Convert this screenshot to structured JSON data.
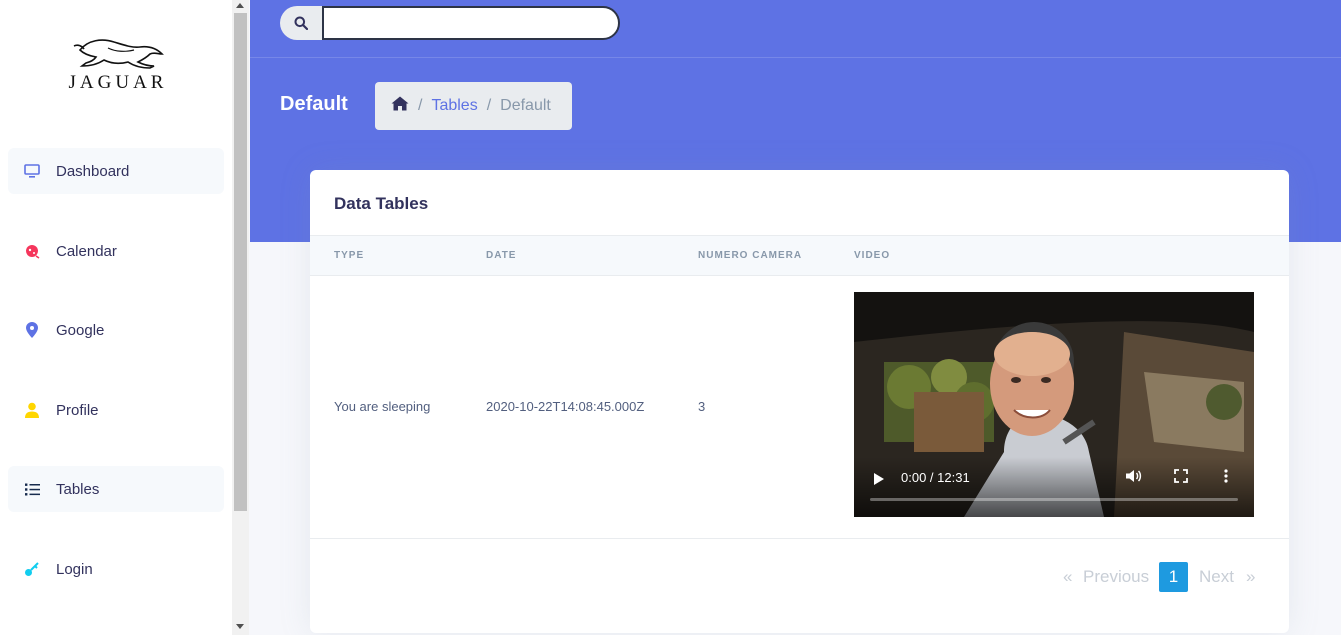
{
  "brand": {
    "name": "JAGUAR"
  },
  "sidebar": {
    "items": [
      {
        "label": "Dashboard",
        "icon": "monitor-icon",
        "color": "#5e72e4",
        "active": true
      },
      {
        "label": "Calendar",
        "icon": "planet-icon",
        "color": "#f5365c",
        "active": false
      },
      {
        "label": "Google",
        "icon": "pin-icon",
        "color": "#5e72e4",
        "active": false
      },
      {
        "label": "Profile",
        "icon": "user-icon",
        "color": "#ffd600",
        "active": false
      },
      {
        "label": "Tables",
        "icon": "bullet-list-icon",
        "color": "#172b4d",
        "active": true
      },
      {
        "label": "Login",
        "icon": "key-icon",
        "color": "#11cdef",
        "active": false
      }
    ]
  },
  "search": {
    "value": "",
    "placeholder": ""
  },
  "header": {
    "title": "Default",
    "breadcrumb": {
      "home_icon": "home-icon",
      "items": [
        "Tables",
        "Default"
      ],
      "separator": "/"
    }
  },
  "card": {
    "title": "Data Tables",
    "columns": [
      "Type",
      "Date",
      "Numero camera",
      "Video"
    ],
    "rows": [
      {
        "type": "You are sleeping",
        "date": "2020-10-22T14:08:45.000Z",
        "camera": "3",
        "video_time": "0:00 / 12:31",
        "video_progress": 0
      }
    ]
  },
  "pagination": {
    "first": "«",
    "previous": "Previous",
    "current": "1",
    "next": "Next",
    "last": "»"
  },
  "colors": {
    "primary": "#5e72e4",
    "active_page": "#1e9ae0",
    "text": "#525f7f",
    "heading": "#32325d"
  }
}
